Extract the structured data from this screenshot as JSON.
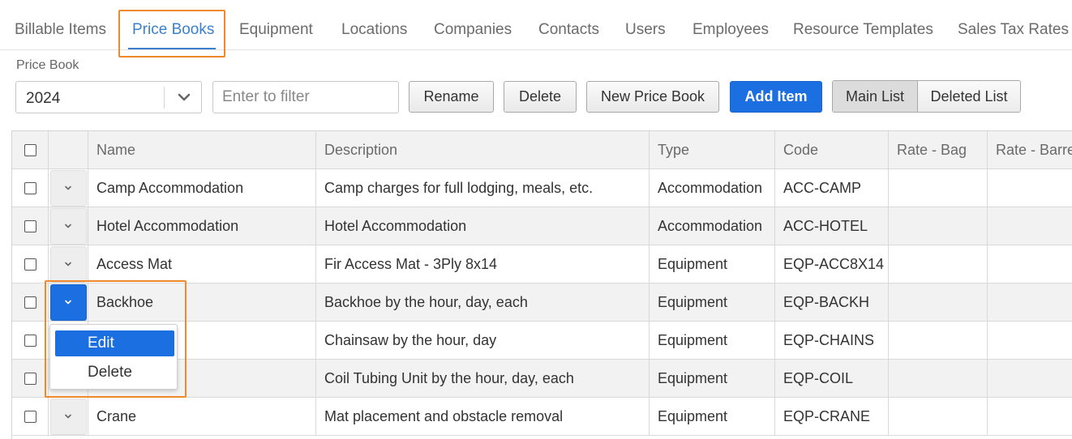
{
  "tabs": [
    {
      "label": "Billable Items"
    },
    {
      "label": "Price Books"
    },
    {
      "label": "Equipment"
    },
    {
      "label": "Locations"
    },
    {
      "label": "Companies"
    },
    {
      "label": "Contacts"
    },
    {
      "label": "Users"
    },
    {
      "label": "Employees"
    },
    {
      "label": "Resource Templates"
    },
    {
      "label": "Sales Tax Rates"
    }
  ],
  "active_tab": "Price Books",
  "toolbar": {
    "price_book_label": "Price Book",
    "price_book_value": "2024",
    "filter_placeholder": "Enter to filter",
    "rename_label": "Rename",
    "delete_label": "Delete",
    "new_price_book_label": "New Price Book",
    "add_item_label": "Add Item",
    "main_list_label": "Main List",
    "deleted_list_label": "Deleted List"
  },
  "table": {
    "columns": [
      "Name",
      "Description",
      "Type",
      "Code",
      "Rate - Bag",
      "Rate - Barre"
    ],
    "rows": [
      {
        "name": "Camp Accommodation",
        "description": "Camp charges for full lodging, meals, etc.",
        "type": "Accommodation",
        "code": "ACC-CAMP"
      },
      {
        "name": "Hotel Accommodation",
        "description": "Hotel Accommodation",
        "type": "Accommodation",
        "code": "ACC-HOTEL"
      },
      {
        "name": "Access Mat",
        "description": "Fir Access Mat - 3Ply 8x14",
        "type": "Equipment",
        "code": "EQP-ACC8X14"
      },
      {
        "name": "Backhoe",
        "description": "Backhoe by the hour, day, each",
        "type": "Equipment",
        "code": "EQP-BACKH"
      },
      {
        "name": "",
        "description": "Chainsaw by the hour, day",
        "type": "Equipment",
        "code": "EQP-CHAINS"
      },
      {
        "name": "",
        "description": "Coil Tubing Unit by the hour, day, each",
        "type": "Equipment",
        "code": "EQP-COIL"
      },
      {
        "name": "Crane",
        "description": "Mat placement and obstacle removal",
        "type": "Equipment",
        "code": "EQP-CRANE"
      }
    ]
  },
  "row_menu": {
    "edit_label": "Edit",
    "delete_label": "Delete"
  },
  "colors": {
    "accent": "#1c6fe0",
    "active_tab": "#3a7fd0",
    "highlight": "#f0892e"
  }
}
